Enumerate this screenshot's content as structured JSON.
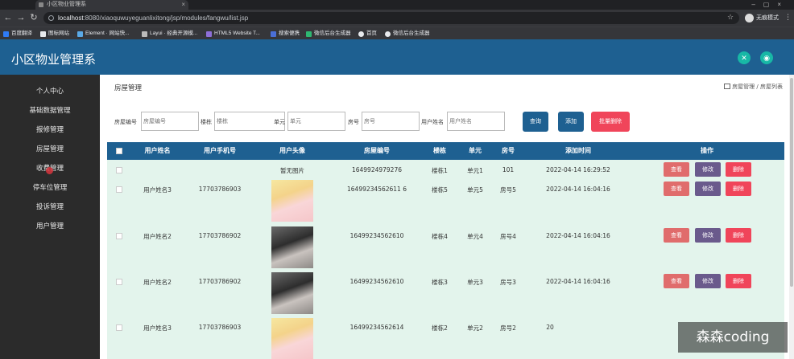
{
  "browser": {
    "tab_title": "小区物业管理系",
    "url_host": "localhost",
    "url_rest": ":8080/xiaoquwuyeguanlixitong/jsp/modules/fangwu/list.jsp",
    "profile_label": "无痕模式",
    "bookmarks": [
      "百度翻译",
      "图标网站",
      "Element · 网站快...",
      "Layui · 经典开源模...",
      "HTML5 Website T...",
      "搜索便携",
      "微信后台生成器",
      "首页",
      "微信后台生成器"
    ]
  },
  "app": {
    "title": "小区物业管理系"
  },
  "sidebar": {
    "items": [
      "个人中心",
      "基础数据管理",
      "报修管理",
      "房屋管理",
      "收费管理",
      "停车位管理",
      "投诉管理",
      "用户管理"
    ]
  },
  "page": {
    "title": "房屋管理",
    "breadcrumb": "房屋管理 / 房屋列表"
  },
  "search": {
    "fields": [
      {
        "label": "房屋编号",
        "placeholder": "房屋编号"
      },
      {
        "label": "楼栋",
        "placeholder": "楼栋"
      },
      {
        "label": "单元",
        "placeholder": "单元"
      },
      {
        "label": "房号",
        "placeholder": "房号"
      },
      {
        "label": "用户姓名",
        "placeholder": "用户姓名"
      }
    ],
    "query_button": "查询",
    "add_button": "添加",
    "batch_delete_button": "批量删除"
  },
  "table": {
    "headers": [
      "用户姓名",
      "用户手机号",
      "用户头像",
      "房屋编号",
      "楼栋",
      "单元",
      "房号",
      "添加时间",
      "操作"
    ],
    "no_image_text": "暂无图片",
    "actions": [
      "查看",
      "修改",
      "删除"
    ],
    "rows": [
      {
        "name": "",
        "phone": "",
        "avatar": "none",
        "house_no": "1649924979276",
        "building": "楼栋1",
        "unit": "单元1",
        "room": "101",
        "time": "2022-04-14 16:29:52"
      },
      {
        "name": "用户姓名3",
        "phone": "17703786903",
        "avatar": "anime",
        "house_no": "16499234562611 6",
        "building": "楼栋5",
        "unit": "单元5",
        "room": "房号5",
        "time": "2022-04-14 16:04:16"
      },
      {
        "name": "用户姓名2",
        "phone": "17703786902",
        "avatar": "photo",
        "house_no": "16499234562610",
        "building": "楼栋4",
        "unit": "单元4",
        "room": "房号4",
        "time": "2022-04-14 16:04:16"
      },
      {
        "name": "用户姓名2",
        "phone": "17703786902",
        "avatar": "photo",
        "house_no": "16499234562610",
        "building": "楼栋3",
        "unit": "单元3",
        "room": "房号3",
        "time": "2022-04-14 16:04:16"
      },
      {
        "name": "用户姓名3",
        "phone": "17703786903",
        "avatar": "anime",
        "house_no": "16499234562614",
        "building": "楼栋2",
        "unit": "单元2",
        "room": "房号2",
        "time": "20"
      }
    ]
  },
  "watermark": "森森coding",
  "colors": {
    "primary": "#1e6091",
    "sidebar_bg": "#2b2b2b",
    "row_bg": "#e3f4ec",
    "view_btn": "#e06c6c",
    "edit_btn": "#6a5a8c",
    "delete_btn": "#f0455a",
    "add_btn": "#1e6091",
    "batch_delete_btn": "#f0455a"
  }
}
